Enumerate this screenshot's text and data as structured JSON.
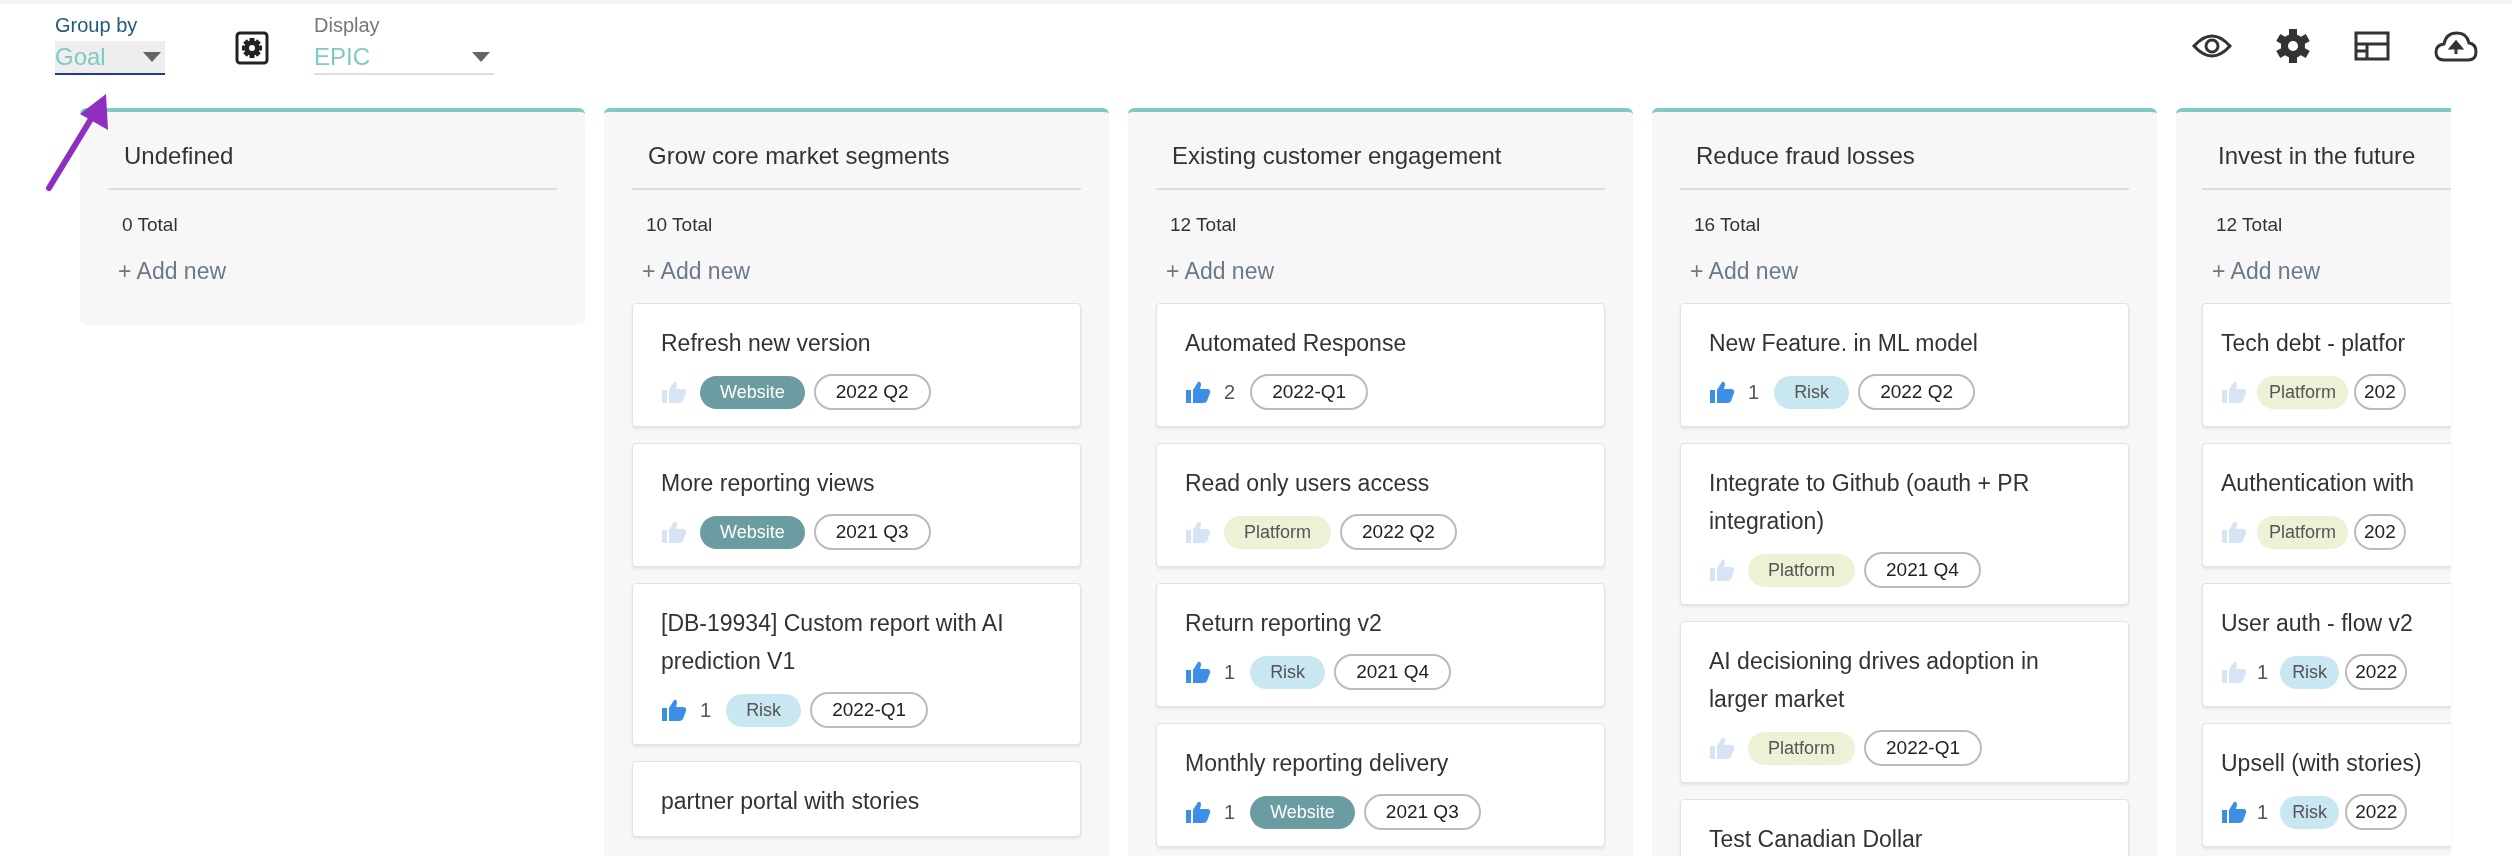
{
  "toolbar": {
    "group_by": {
      "label": "Group by",
      "value": "Goal"
    },
    "display": {
      "label": "Display",
      "value": "EPIC"
    }
  },
  "annotation": {
    "kind": "arrow",
    "color": "#8e2fbf"
  },
  "columns": [
    {
      "title": "Undefined",
      "total": "0 Total",
      "add_label": "+ Add new"
    },
    {
      "title": "Grow core market segments",
      "total": "10 Total",
      "add_label": "+ Add new",
      "cards": [
        {
          "title": "Refresh new version",
          "liked": false,
          "tags": [
            {
              "kind": "label",
              "label": "Website",
              "color": "#6a9ca1"
            },
            {
              "kind": "period",
              "label": "2022 Q2"
            }
          ]
        },
        {
          "title": "More reporting views",
          "liked": false,
          "tags": [
            {
              "kind": "label",
              "label": "Website",
              "color": "#6a9ca1"
            },
            {
              "kind": "period",
              "label": "2021 Q3"
            }
          ]
        },
        {
          "title": "[DB-19934] Custom report with AI prediction V1",
          "liked": true,
          "votes": "1",
          "tags": [
            {
              "kind": "label",
              "label": "Risk",
              "color": "#c8e7f1"
            },
            {
              "kind": "period",
              "label": "2022-Q1"
            }
          ]
        },
        {
          "title": "partner portal with stories"
        }
      ]
    },
    {
      "title": "Existing customer engagement",
      "total": "12 Total",
      "add_label": "+ Add new",
      "cards": [
        {
          "title": "Automated Response",
          "liked": true,
          "votes": "2",
          "tags": [
            {
              "kind": "period",
              "label": "2022-Q1"
            }
          ]
        },
        {
          "title": "Read only users access",
          "liked": false,
          "tags": [
            {
              "kind": "label",
              "label": "Platform",
              "color": "#eef1d6"
            },
            {
              "kind": "period",
              "label": "2022 Q2"
            }
          ]
        },
        {
          "title": "Return reporting v2",
          "liked": true,
          "votes": "1",
          "tags": [
            {
              "kind": "label",
              "label": "Risk",
              "color": "#c8e7f1"
            },
            {
              "kind": "period",
              "label": "2021 Q4"
            }
          ]
        },
        {
          "title": "Monthly reporting delivery",
          "liked": true,
          "votes": "1",
          "tags": [
            {
              "kind": "label",
              "label": "Website",
              "color": "#6a9ca1"
            },
            {
              "kind": "period",
              "label": "2021 Q3"
            }
          ]
        }
      ]
    },
    {
      "title": "Reduce fraud losses",
      "total": "16 Total",
      "add_label": "+ Add new",
      "cards": [
        {
          "title": "New Feature. in ML model",
          "liked": true,
          "votes": "1",
          "tags": [
            {
              "kind": "label",
              "label": "Risk",
              "color": "#c8e7f1"
            },
            {
              "kind": "period",
              "label": "2022 Q2"
            }
          ]
        },
        {
          "title": "Integrate to Github (oauth + PR integration)",
          "liked": false,
          "tags": [
            {
              "kind": "label",
              "label": "Platform",
              "color": "#eef1d6"
            },
            {
              "kind": "period",
              "label": "2021 Q4"
            }
          ]
        },
        {
          "title": "AI decisioning drives adoption in larger market",
          "liked": false,
          "tags": [
            {
              "kind": "label",
              "label": "Platform",
              "color": "#eef1d6"
            },
            {
              "kind": "period",
              "label": "2022-Q1"
            }
          ]
        },
        {
          "title": "Test Canadian Dollar"
        }
      ]
    },
    {
      "title": "Invest in the future",
      "total": "12 Total",
      "add_label": "+ Add new",
      "cut": true,
      "cards": [
        {
          "title": "Tech debt - platfor",
          "liked": false,
          "tags": [
            {
              "kind": "label",
              "label": "Platform",
              "color": "#eef1d6"
            },
            {
              "kind": "period",
              "label": "202"
            }
          ]
        },
        {
          "title": "Authentication with",
          "liked": false,
          "tags": [
            {
              "kind": "label",
              "label": "Platform",
              "color": "#eef1d6"
            },
            {
              "kind": "period",
              "label": "202"
            }
          ]
        },
        {
          "title": "User auth - flow v2",
          "liked": false,
          "votes": "1",
          "tags": [
            {
              "kind": "label",
              "label": "Risk",
              "color": "#c8e7f1"
            },
            {
              "kind": "period",
              "label": "2022"
            }
          ]
        },
        {
          "title": "Upsell (with stories)",
          "liked": true,
          "votes": "1",
          "tags": [
            {
              "kind": "label",
              "label": "Risk",
              "color": "#c8e7f1"
            },
            {
              "kind": "period",
              "label": "2022"
            }
          ]
        }
      ]
    }
  ]
}
